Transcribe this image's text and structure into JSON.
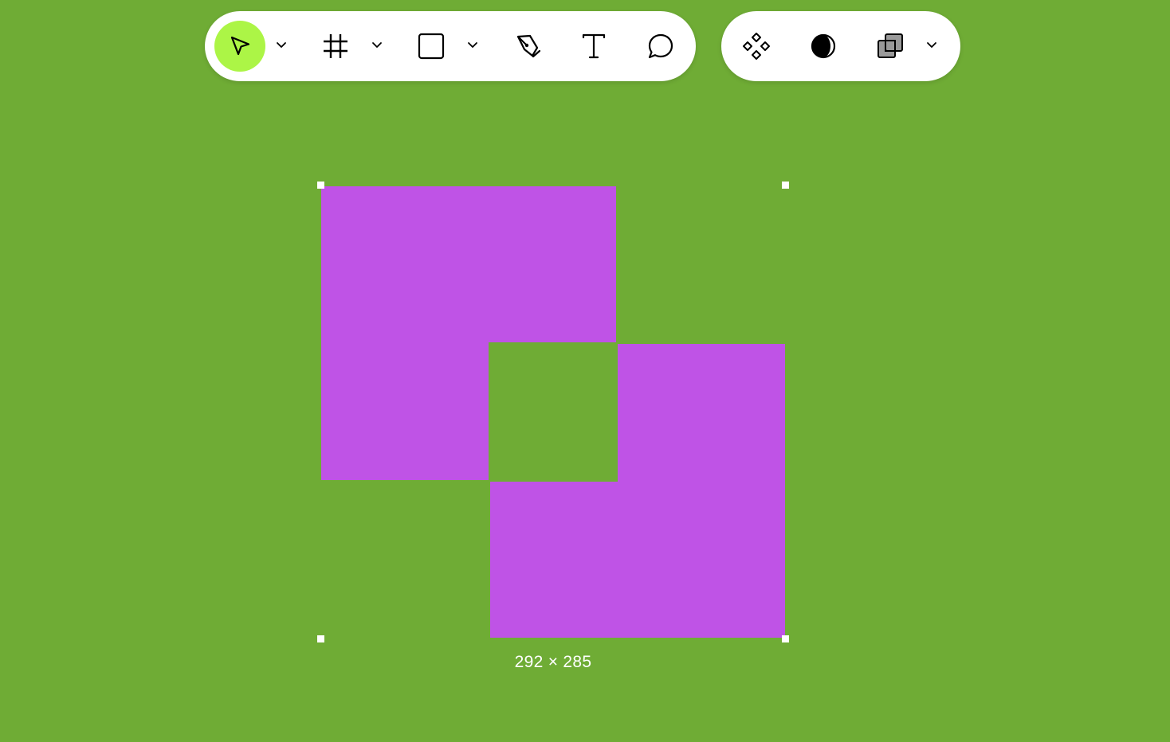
{
  "toolbar_main": {
    "tools": [
      {
        "name": "move",
        "icon": "cursor-arrow-icon",
        "active": true,
        "has_menu": true
      },
      {
        "name": "frame",
        "icon": "frame-hash-icon",
        "active": false,
        "has_menu": true
      },
      {
        "name": "rectangle",
        "icon": "rectangle-icon",
        "active": false,
        "has_menu": true
      },
      {
        "name": "pen",
        "icon": "pen-icon",
        "active": false,
        "has_menu": false
      },
      {
        "name": "text",
        "icon": "text-t-icon",
        "active": false,
        "has_menu": false
      },
      {
        "name": "comment",
        "icon": "comment-bubble-icon",
        "active": false,
        "has_menu": false
      }
    ]
  },
  "toolbar_side": {
    "tools": [
      {
        "name": "components",
        "icon": "components-diamond-icon",
        "has_menu": false
      },
      {
        "name": "mask",
        "icon": "half-circle-contrast-icon",
        "has_menu": false
      },
      {
        "name": "boolean",
        "icon": "boolean-union-squares-icon",
        "has_menu": true
      }
    ]
  },
  "canvas": {
    "background_color": "#6fac35",
    "shape_color": "#bf53e6",
    "active_tool_color": "#acf546",
    "selection": {
      "dimensions_label": "292 × 285"
    }
  }
}
